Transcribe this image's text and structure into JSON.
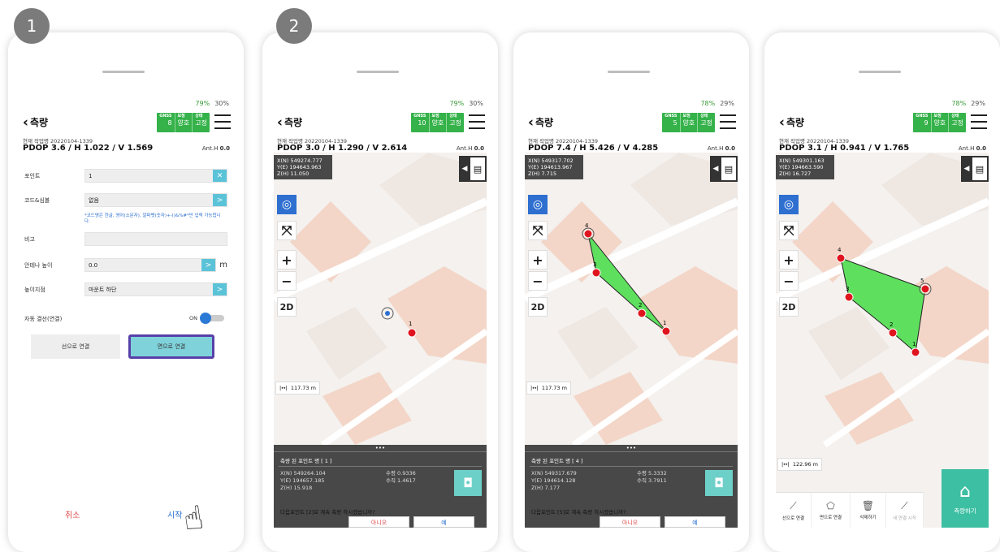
{
  "badges": [
    "1",
    "2"
  ],
  "common": {
    "back_label": "측량",
    "gnss_label": "GNSS",
    "fix_label": "보정",
    "state_label": "상태",
    "job_prefix": "현재 작업명 20220104-1339",
    "anth_label": "Ant.H",
    "anth_value": "0.0"
  },
  "phone1": {
    "status": {
      "battery1": "79%",
      "battery2": "30%"
    },
    "gnss": {
      "sats": "8",
      "fix": "양호",
      "state": "고정"
    },
    "job": "현재 작업명 20220104-1339",
    "pdop": "PDOP 3.6 / H 1.022 / V 1.569",
    "form": {
      "point_label": "포인트",
      "point_value": "1",
      "point_btn": "✕",
      "code_label": "코드&심볼",
      "code_value": "없음",
      "code_btn": ">",
      "code_note": "*코드명은 한글, 영어(소문자), 알파벳(숫자)+-()&%#*만 입력 가능합니다.",
      "memo_label": "비고",
      "memo_value": "",
      "ant_label": "안테나 높이",
      "ant_value": "0.0",
      "ant_btn": ">",
      "ant_unit": "m",
      "height_label": "높이지점",
      "height_value": "마운트 하단",
      "height_btn": ">",
      "auto_label": "자동 결선(연결)",
      "auto_state": "ON",
      "line_btn": "선으로 연결",
      "area_btn": "면으로 연결"
    },
    "cancel": "취소",
    "start": "시작"
  },
  "phone2": {
    "status": {
      "battery1": "79%",
      "battery2": "30%"
    },
    "gnss": {
      "sats": "10",
      "fix": "양호",
      "state": "고정"
    },
    "pdop": "PDOP 3.0 / H 1.290 / V 2.614",
    "coord": {
      "n": "X(N) 549274.777",
      "e": "Y(E) 194643.963",
      "h": "Z(H) 11.050"
    },
    "scale": "117.73 m",
    "panel": {
      "title": "측량 된 포인트 명 [ 1 ]",
      "n": "X(N) 549264.104",
      "e": "Y(E) 194657.185",
      "h": "Z(H) 15.918",
      "hp": "수평 0.9336",
      "vp": "수직 1.4617",
      "question": "다음포인트 [2]로 계속 측량 하시겠습니까?",
      "no": "아니오",
      "yes": "예"
    }
  },
  "phone3": {
    "status": {
      "battery1": "78%",
      "battery2": "29%"
    },
    "gnss": {
      "sats": "5",
      "fix": "양호",
      "state": "고정"
    },
    "pdop": "PDOP 7.4 / H 5.426 / V 4.285",
    "coord": {
      "n": "X(N) 549317.702",
      "e": "Y(E) 194613.967",
      "h": "Z(H) 7.715"
    },
    "scale": "117.73 m",
    "panel": {
      "title": "측량 된 포인트 명 [ 4 ]",
      "n": "X(N) 549317.679",
      "e": "Y(E) 194614.128",
      "h": "Z(H) 7.177",
      "hp": "수평 5.3332",
      "vp": "수직 3.7911",
      "question": "다음포인트 [5]로 계속 측량 하시겠습니까?",
      "no": "아니오",
      "yes": "예"
    }
  },
  "phone4": {
    "status": {
      "battery1": "78%",
      "battery2": "29%"
    },
    "gnss": {
      "sats": "9",
      "fix": "양호",
      "state": "고정"
    },
    "pdop": "PDOP 3.1 / H 0.941 / V 1.765",
    "coord": {
      "n": "X(N) 549301.163",
      "e": "Y(E) 194663.590",
      "h": "Z(H) 16.727"
    },
    "scale": "122.96 m",
    "tools": {
      "line": "선으로 연결",
      "area": "면으로 연결",
      "delete": "삭제하기",
      "new": "새 연결 시작",
      "survey": "측량하기"
    }
  },
  "map_controls": {
    "mode": "2D"
  },
  "colors": {
    "accent": "#5bc3d8",
    "gnss": "#35b24a",
    "point": "#e0141e",
    "polygon": "#5ee05e",
    "survey_btn": "#3cbfa2"
  }
}
